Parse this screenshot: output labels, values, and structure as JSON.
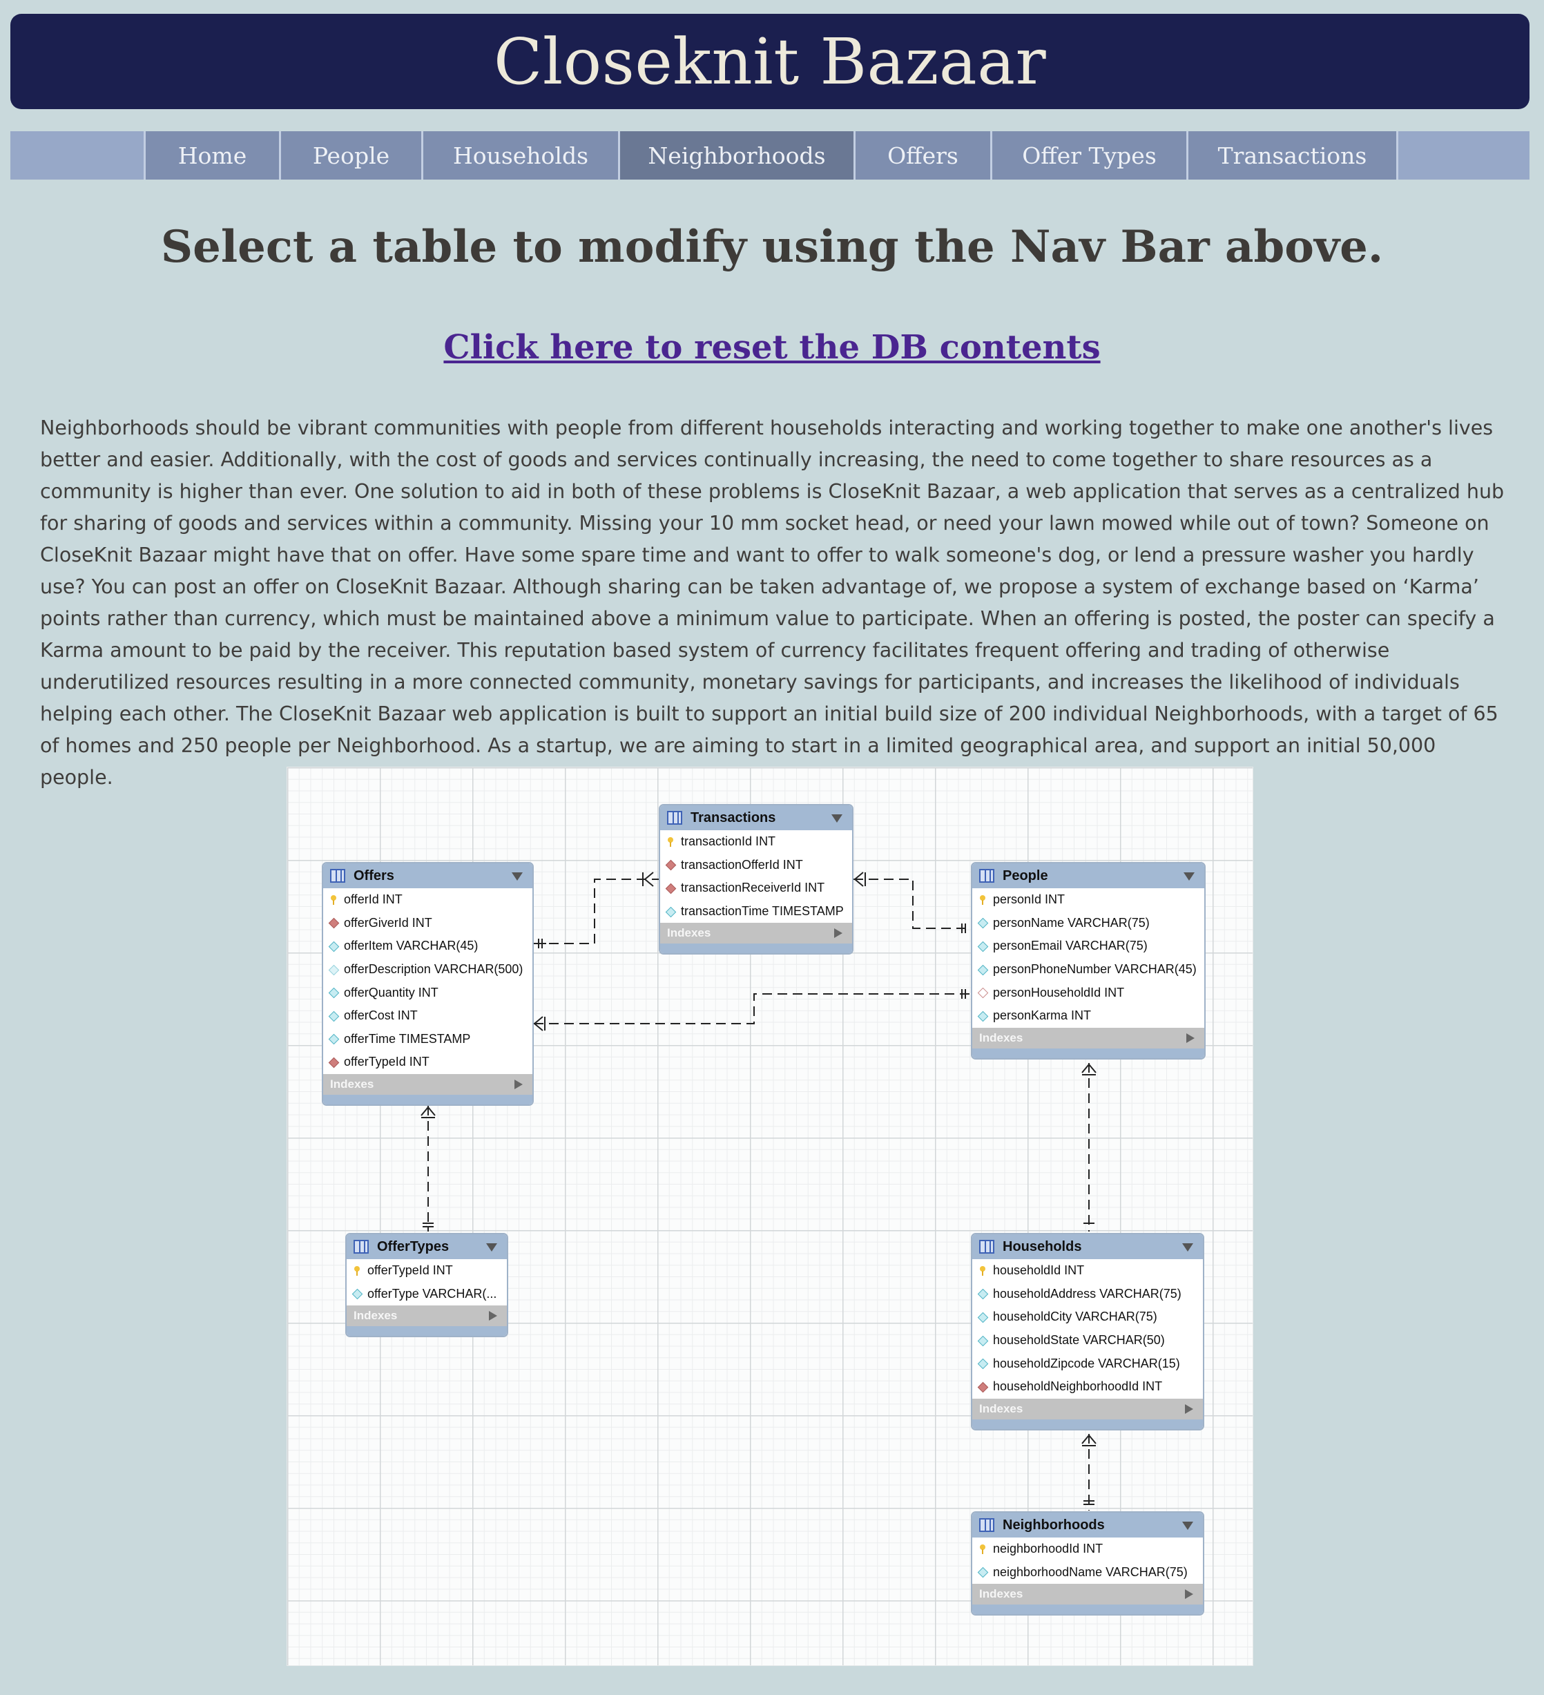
{
  "app": {
    "title": "Closeknit Bazaar"
  },
  "nav": {
    "items": [
      {
        "label": "Home"
      },
      {
        "label": "People"
      },
      {
        "label": "Households"
      },
      {
        "label": "Neighborhoods"
      },
      {
        "label": "Offers"
      },
      {
        "label": "Offer Types"
      },
      {
        "label": "Transactions"
      }
    ]
  },
  "main": {
    "heading": "Select a table to modify using the Nav Bar above.",
    "reset_link": "Click here to reset the DB contents",
    "about": "Neighborhoods should be vibrant communities with people from different households interacting and working together to make one another's lives better and easier. Additionally, with the cost of goods and services continually increasing, the need to come together to share resources as a community is higher than ever. One solution to aid in both of these problems is CloseKnit Bazaar, a web application that serves as a centralized hub for sharing of goods and services within a community. Missing your 10 mm socket head, or need your lawn mowed while out of town? Someone on CloseKnit Bazaar might have that on offer. Have some spare time and want to offer to walk someone's dog, or lend a pressure washer you hardly use? You can post an offer on CloseKnit Bazaar. Although sharing can be taken advantage of, we propose a system of exchange based on ‘Karma’ points rather than currency, which must be maintained above a minimum value to participate. When an offering is posted, the poster can specify a Karma amount to be paid by the receiver. This reputation based system of currency facilitates frequent offering and trading of otherwise underutilized resources resulting in a more connected community, monetary savings for participants, and increases the likelihood of individuals helping each other. The CloseKnit Bazaar web application is built to support an initial build size of 200 individual Neighborhoods, with a target of 65 of homes and 250 people per Neighborhood. As a startup, we are aiming to start in a limited geographical area, and support an initial 50,000 people."
  },
  "erd": {
    "indexes_label": "Indexes",
    "tables": {
      "transactions": {
        "name": "Transactions",
        "columns": [
          {
            "text": "transactionId INT",
            "key": "pk"
          },
          {
            "text": "transactionOfferId INT",
            "key": "fk"
          },
          {
            "text": "transactionReceiverId INT",
            "key": "fk"
          },
          {
            "text": "transactionTime TIMESTAMP",
            "key": "col"
          }
        ]
      },
      "offers": {
        "name": "Offers",
        "columns": [
          {
            "text": "offerId INT",
            "key": "pk"
          },
          {
            "text": "offerGiverId INT",
            "key": "fk"
          },
          {
            "text": "offerItem VARCHAR(45)",
            "key": "col"
          },
          {
            "text": "offerDescription VARCHAR(500)",
            "key": "col-open"
          },
          {
            "text": "offerQuantity INT",
            "key": "col"
          },
          {
            "text": "offerCost INT",
            "key": "col"
          },
          {
            "text": "offerTime TIMESTAMP",
            "key": "col"
          },
          {
            "text": "offerTypeId INT",
            "key": "fk"
          }
        ]
      },
      "people": {
        "name": "People",
        "columns": [
          {
            "text": "personId INT",
            "key": "pk"
          },
          {
            "text": "personName VARCHAR(75)",
            "key": "col"
          },
          {
            "text": "personEmail VARCHAR(75)",
            "key": "col"
          },
          {
            "text": "personPhoneNumber VARCHAR(45)",
            "key": "col"
          },
          {
            "text": "personHouseholdId INT",
            "key": "fk-open"
          },
          {
            "text": "personKarma INT",
            "key": "col"
          }
        ]
      },
      "offertypes": {
        "name": "OfferTypes",
        "columns": [
          {
            "text": "offerTypeId INT",
            "key": "pk"
          },
          {
            "text": "offerType VARCHAR(...",
            "key": "col"
          }
        ]
      },
      "households": {
        "name": "Households",
        "columns": [
          {
            "text": "householdId INT",
            "key": "pk"
          },
          {
            "text": "householdAddress VARCHAR(75)",
            "key": "col"
          },
          {
            "text": "householdCity VARCHAR(75)",
            "key": "col"
          },
          {
            "text": "householdState VARCHAR(50)",
            "key": "col"
          },
          {
            "text": "householdZipcode VARCHAR(15)",
            "key": "col"
          },
          {
            "text": "householdNeighborhoodId INT",
            "key": "fk"
          }
        ]
      },
      "neighborhoods": {
        "name": "Neighborhoods",
        "columns": [
          {
            "text": "neighborhoodId INT",
            "key": "pk"
          },
          {
            "text": "neighborhoodName VARCHAR(75)",
            "key": "col"
          }
        ]
      }
    }
  }
}
